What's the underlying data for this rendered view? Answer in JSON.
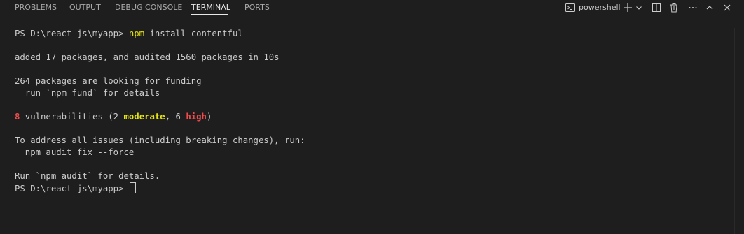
{
  "tabs": [
    {
      "label": "PROBLEMS"
    },
    {
      "label": "OUTPUT"
    },
    {
      "label": "DEBUG CONSOLE"
    },
    {
      "label": "TERMINAL",
      "active": true
    },
    {
      "label": "PORTS"
    }
  ],
  "toolbar": {
    "shell_name": "powershell",
    "icons": [
      "terminal-icon",
      "plus-icon",
      "chevron-down-icon",
      "split-icon",
      "trash-icon",
      "more-icon",
      "chevron-up-icon",
      "close-icon"
    ]
  },
  "terminal": {
    "prompt": "PS D:\\react-js\\myapp> ",
    "command_name": "npm",
    "command_args": " install contentful",
    "line_added": "added 17 packages, and audited 1560 packages in 10s",
    "line_funding": "264 packages are looking for funding",
    "line_fund_run": "  run `npm fund` for details",
    "vuln_count": "8",
    "vuln_text_1": " vulnerabilities (2 ",
    "vuln_moderate": "moderate",
    "vuln_text_2": ", 6 ",
    "vuln_high": "high",
    "vuln_text_3": ")",
    "line_address": "To address all issues (including breaking changes), run:",
    "line_fix": "  npm audit fix --force",
    "line_audit": "Run `npm audit` for details.",
    "prompt_end": "PS D:\\react-js\\myapp> "
  },
  "colors": {
    "background": "#1e1e1e",
    "text": "#cccccc",
    "command": "#e5e510",
    "error": "#f14c4c",
    "warning": "#e5e510"
  }
}
